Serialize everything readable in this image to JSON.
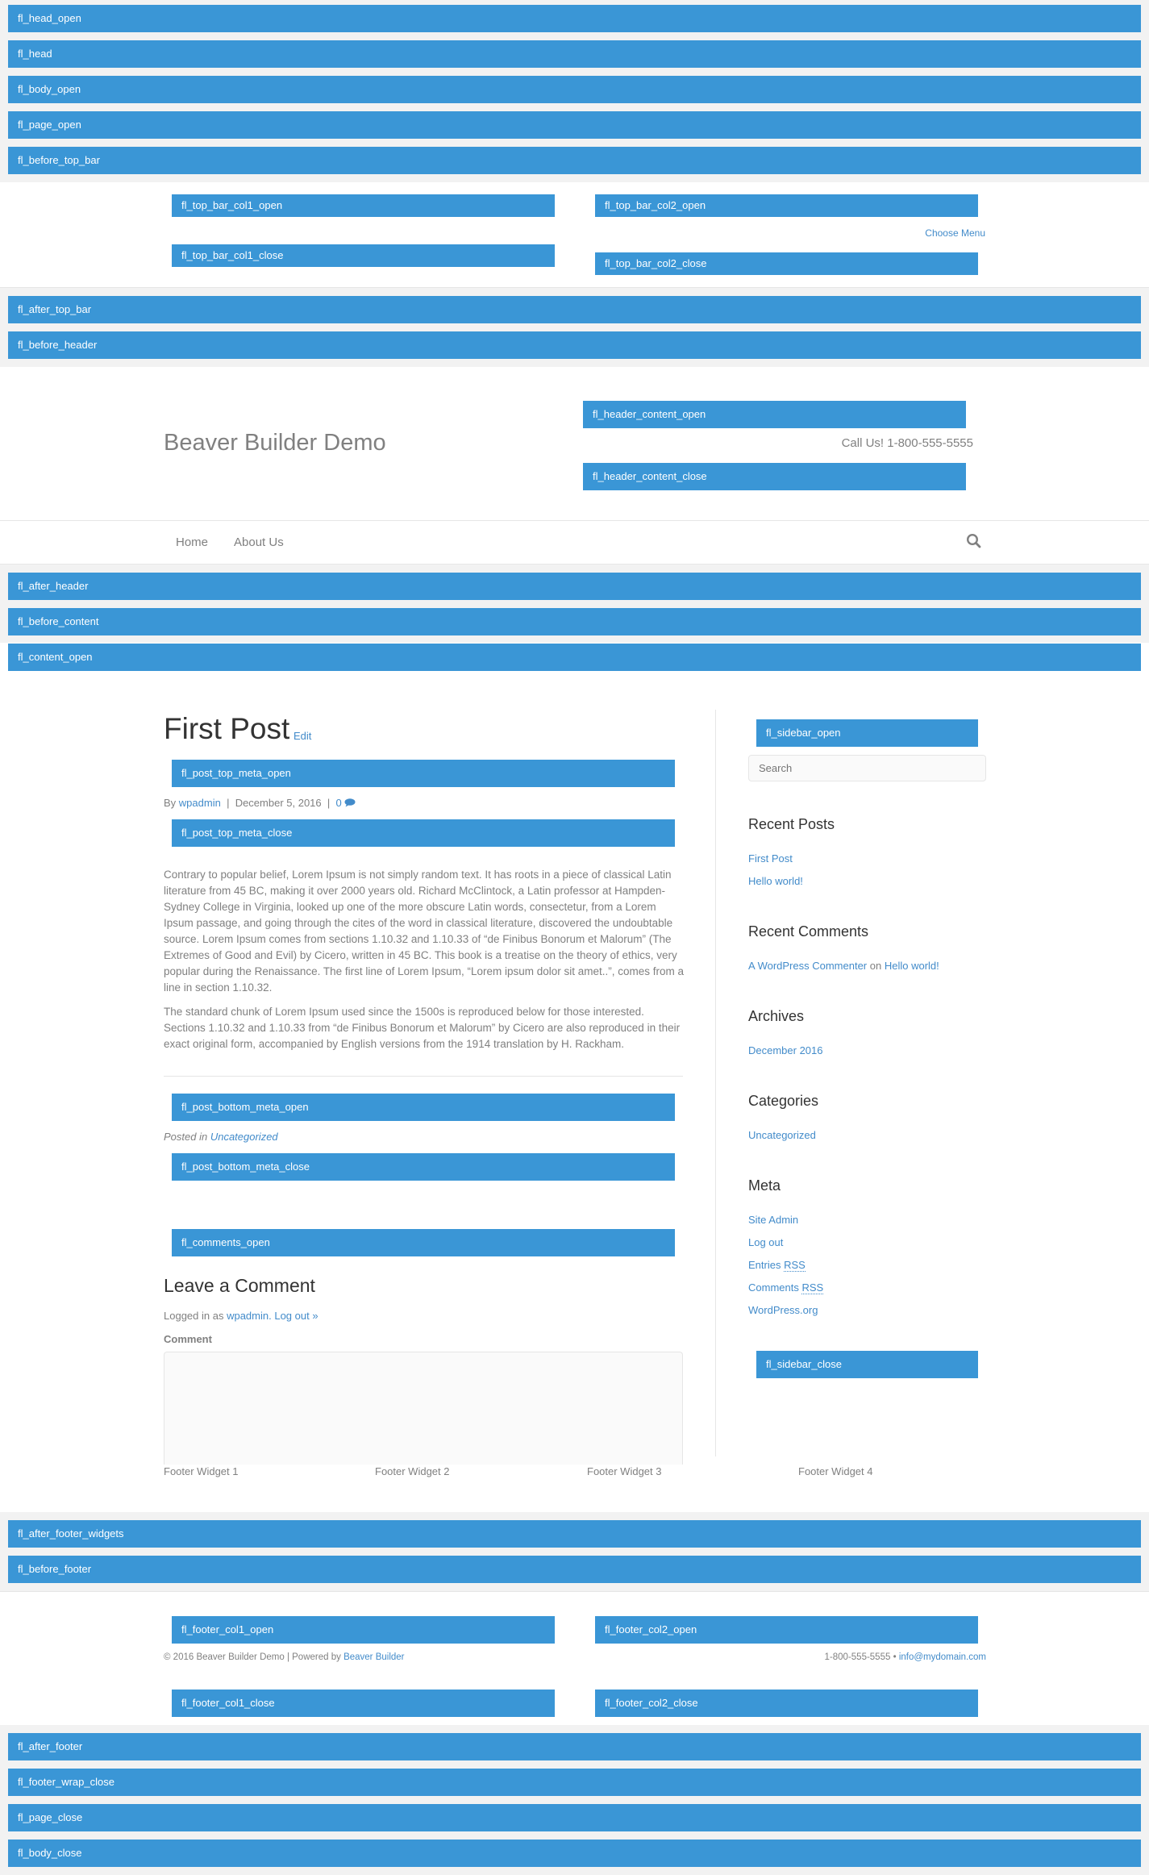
{
  "hooks": {
    "head_open": "fl_head_open",
    "head": "fl_head",
    "body_open": "fl_body_open",
    "page_open": "fl_page_open",
    "before_top_bar": "fl_before_top_bar",
    "top_bar_col1_open": "fl_top_bar_col1_open",
    "top_bar_col1_close": "fl_top_bar_col1_close",
    "top_bar_col2_open": "fl_top_bar_col2_open",
    "top_bar_col2_close": "fl_top_bar_col2_close",
    "after_top_bar": "fl_after_top_bar",
    "before_header": "fl_before_header",
    "header_content_open": "fl_header_content_open",
    "header_content_close": "fl_header_content_close",
    "after_header": "fl_after_header",
    "before_content": "fl_before_content",
    "content_open": "fl_content_open",
    "post_top_meta_open": "fl_post_top_meta_open",
    "post_top_meta_close": "fl_post_top_meta_close",
    "post_bottom_meta_open": "fl_post_bottom_meta_open",
    "post_bottom_meta_close": "fl_post_bottom_meta_close",
    "comments_open": "fl_comments_open",
    "sidebar_open": "fl_sidebar_open",
    "sidebar_close": "fl_sidebar_close",
    "after_footer_widgets": "fl_after_footer_widgets",
    "before_footer": "fl_before_footer",
    "footer_col1_open": "fl_footer_col1_open",
    "footer_col1_close": "fl_footer_col1_close",
    "footer_col2_open": "fl_footer_col2_open",
    "footer_col2_close": "fl_footer_col2_close",
    "after_footer": "fl_after_footer",
    "footer_wrap_close": "fl_footer_wrap_close",
    "page_close": "fl_page_close",
    "body_close": "fl_body_close"
  },
  "top_bar": {
    "choose_menu": "Choose Menu"
  },
  "header": {
    "site_title": "Beaver Builder Demo",
    "call_us": "Call Us! 1-800-555-5555"
  },
  "nav": {
    "items": [
      {
        "label": "Home"
      },
      {
        "label": "About Us"
      }
    ],
    "search_icon": "search-icon"
  },
  "post": {
    "title": "First Post",
    "edit": "Edit",
    "meta": {
      "by": "By",
      "author": "wpadmin",
      "sep": "|",
      "date": "December 5, 2016",
      "comments": "0",
      "comment_icon": "comment-icon"
    },
    "paragraphs": [
      "Contrary to popular belief, Lorem Ipsum is not simply random text. It has roots in a piece of classical Latin literature from 45 BC, making it over 2000 years old. Richard McClintock, a Latin professor at Hampden-Sydney College in Virginia, looked up one of the more obscure Latin words, consectetur, from a Lorem Ipsum passage, and going through the cites of the word in classical literature, discovered the undoubtable source. Lorem Ipsum comes from sections 1.10.32 and 1.10.33 of “de Finibus Bonorum et Malorum” (The Extremes of Good and Evil) by Cicero, written in 45 BC. This book is a treatise on the theory of ethics, very popular during the Renaissance. The first line of Lorem Ipsum, “Lorem ipsum dolor sit amet..”, comes from a line in section 1.10.32.",
      "The standard chunk of Lorem Ipsum used since the 1500s is reproduced below for those interested. Sections 1.10.32 and 1.10.33 from “de Finibus Bonorum et Malorum” by Cicero are also reproduced in their exact original form, accompanied by English versions from the 1914 translation by H. Rackham."
    ],
    "posted_in_label": "Posted in",
    "category": "Uncategorized"
  },
  "comments": {
    "heading": "Leave a Comment",
    "logged_in_as": "Logged in as",
    "user": "wpadmin.",
    "log_out": "Log out »",
    "comment_label": "Comment",
    "comment_value": ""
  },
  "sidebar": {
    "search_placeholder": "Search",
    "recent_posts": {
      "title": "Recent Posts",
      "items": [
        "First Post",
        "Hello world!"
      ]
    },
    "recent_comments": {
      "title": "Recent Comments",
      "author": "A WordPress Commenter",
      "on": "on",
      "post": "Hello world!"
    },
    "archives": {
      "title": "Archives",
      "items": [
        "December 2016"
      ]
    },
    "categories": {
      "title": "Categories",
      "items": [
        "Uncategorized"
      ]
    },
    "meta": {
      "title": "Meta",
      "site_admin": "Site Admin",
      "log_out": "Log out",
      "entries": "Entries",
      "comments": "Comments",
      "rss": "RSS",
      "wordpress": "WordPress.org"
    }
  },
  "footer_widgets": [
    "Footer Widget 1",
    "Footer Widget 2",
    "Footer Widget 3",
    "Footer Widget 4"
  ],
  "footer": {
    "copyright": "© 2016 Beaver Builder Demo | Powered by",
    "powered_link": "Beaver Builder",
    "phone": "1-800-555-5555",
    "dot": "•",
    "email": "info@mydomain.com"
  },
  "colors": {
    "hook_bar": "#3a96d6",
    "link": "#428bca",
    "gray_bg": "#f2f2f2"
  }
}
